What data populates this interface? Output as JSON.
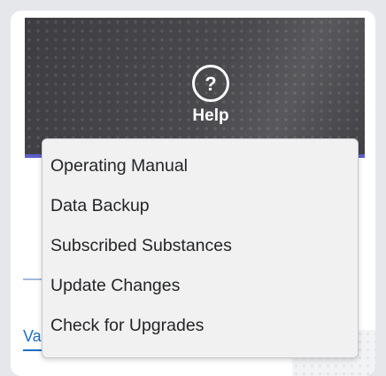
{
  "header": {
    "help_label": "Help",
    "help_icon": "question-circle-icon",
    "help_icon_glyph": "?",
    "accent_color": "#5c5fc9",
    "banner_color": "#3e3e42"
  },
  "background_tab": {
    "partial_text": "Va"
  },
  "help_menu": {
    "items": [
      {
        "label": "Operating Manual"
      },
      {
        "label": "Data Backup"
      },
      {
        "label": "Subscribed Substances"
      },
      {
        "label": "Update Changes"
      },
      {
        "label": "Check for Upgrades"
      }
    ]
  }
}
